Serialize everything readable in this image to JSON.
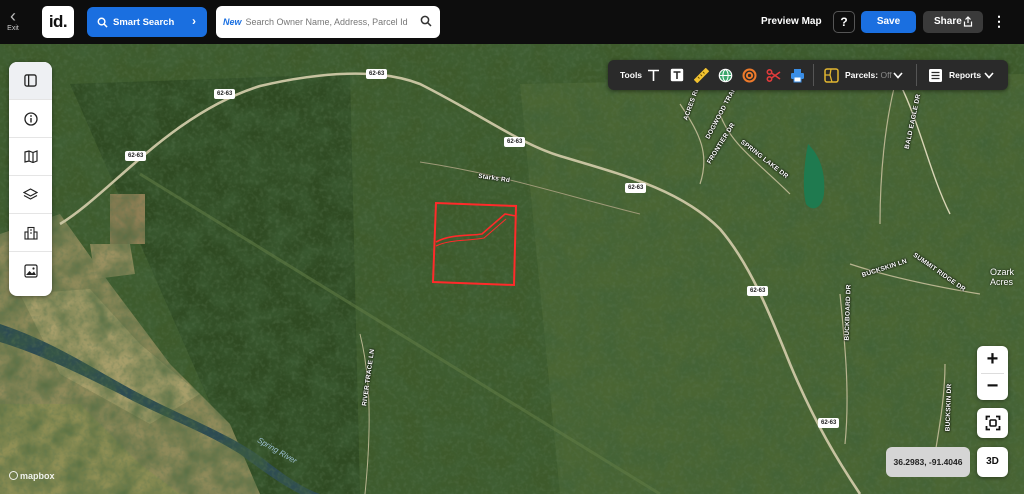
{
  "topbar": {
    "exit_label": "Exit",
    "logo": "id.",
    "smart_search_label": "Smart Search",
    "search_new": "New",
    "search_placeholder": "Search Owner Name, Address, Parcel Id",
    "preview_map_label": "Preview Map",
    "help_label": "?",
    "save_label": "Save",
    "share_label": "Share"
  },
  "tools": {
    "label": "Tools",
    "parcels_label": "Parcels:",
    "parcels_state": "Off",
    "reports_label": "Reports",
    "icons": [
      "text-icon",
      "text-box-icon",
      "ruler-icon",
      "globe-icon",
      "radius-icon",
      "scissors-icon",
      "print-icon",
      "parcel-icon"
    ]
  },
  "left_toolbar": {
    "icons": [
      "panel-icon",
      "info-icon",
      "map-icon",
      "layers-icon",
      "buildings-icon",
      "image-icon"
    ]
  },
  "map": {
    "route_shields": [
      "62-63",
      "62-63",
      "62-63",
      "62-63",
      "62-63",
      "62-63",
      "62-63"
    ],
    "roads": [
      "Starks Rd",
      "ACRES RD",
      "DOGWOOD TRAIL",
      "FRONTIER DR",
      "SPRING LAKE DR",
      "BALD EAGLE DR",
      "BUCKSKIN LN",
      "SUMMIT RIDGE DR",
      "BUCKBOARD DR",
      "BUCKSKIN DR",
      "RIVER TRACE LN"
    ],
    "places": [
      "Ozark",
      "Acres"
    ],
    "river": "Spring River",
    "parcel_outline_color": "#ff2a2a"
  },
  "controls": {
    "zoom_in": "+",
    "zoom_out": "−",
    "coordinates": "36.2983, -91.4046",
    "three_d": "3D",
    "mapbox": "mapbox"
  }
}
